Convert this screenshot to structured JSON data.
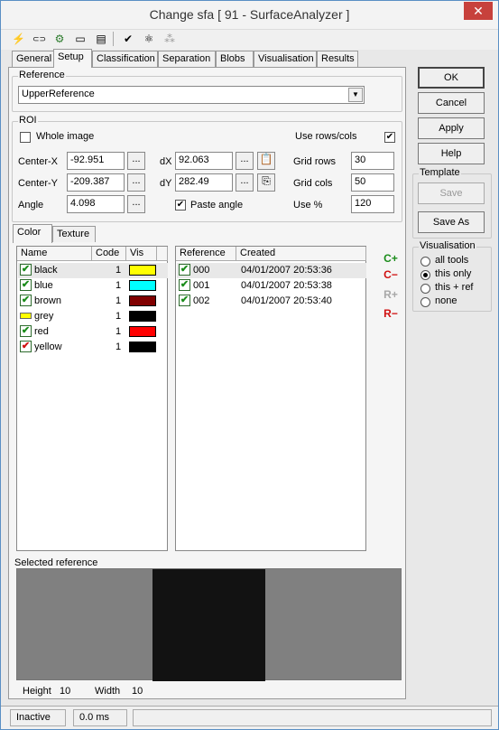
{
  "window": {
    "title": "Change sfa [ 91 - SurfaceAnalyzer ]",
    "close": "✕"
  },
  "toolbar": [
    "⚡",
    "⊂⊃",
    "⚙",
    "▭",
    "▤",
    "✔",
    "⚛",
    "⁂"
  ],
  "tabs": [
    "General",
    "Setup",
    "Classification",
    "Separation",
    "Blobs",
    "Visualisation",
    "Results"
  ],
  "reference": {
    "legend": "Reference",
    "value": "UpperReference",
    "arrow": "▼"
  },
  "roi": {
    "legend": "ROI",
    "whole_image": "Whole image",
    "use_rows_cols": "Use rows/cols",
    "use_rows_cols_checked": "✔",
    "center_x_label": "Center-X",
    "center_x": "-92.951",
    "center_y_label": "Center-Y",
    "center_y": "-209.387",
    "angle_label": "Angle",
    "angle": "4.098",
    "dx_label": "dX",
    "dx": "92.063",
    "dy_label": "dY",
    "dy": "282.49",
    "paste_angle": "Paste angle",
    "paste_angle_checked": "✔",
    "grid_rows_label": "Grid rows",
    "grid_rows": "30",
    "grid_cols_label": "Grid cols",
    "grid_cols": "50",
    "use_pct_label": "Use %",
    "use_pct": "120",
    "ellipsis": "..."
  },
  "subtabs": [
    "Color",
    "Texture"
  ],
  "colors": {
    "headers": [
      "Name",
      "Code",
      "Vis"
    ],
    "rows": [
      {
        "name": "black",
        "code": "1",
        "check": "✔",
        "swatch": "#ffff00"
      },
      {
        "name": "blue",
        "code": "1",
        "check": "✔",
        "swatch": "#00ffff"
      },
      {
        "name": "brown",
        "code": "1",
        "check": "✔",
        "swatch": "#800000"
      },
      {
        "name": "grey",
        "code": "1",
        "check": "",
        "swatch": "#000000"
      },
      {
        "name": "red",
        "code": "1",
        "check": "✔",
        "swatch": "#ff0000"
      },
      {
        "name": "yellow",
        "code": "1",
        "check": "✔",
        "swatch": "#000000"
      }
    ]
  },
  "refs": {
    "headers": [
      "Reference",
      "Created"
    ],
    "rows": [
      {
        "ref": "000",
        "created": "04/01/2007 20:53:36",
        "check": "✔"
      },
      {
        "ref": "001",
        "created": "04/01/2007 20:53:38",
        "check": "✔"
      },
      {
        "ref": "002",
        "created": "04/01/2007 20:53:40",
        "check": "✔"
      }
    ]
  },
  "side_tools": {
    "c_plus": "C+",
    "c_minus": "C−",
    "r_plus": "R+",
    "r_minus": "R−"
  },
  "selected": {
    "label": "Selected reference",
    "height_label": "Height",
    "height": "10",
    "width_label": "Width",
    "width": "10"
  },
  "buttons": {
    "ok": "OK",
    "cancel": "Cancel",
    "apply": "Apply",
    "help": "Help"
  },
  "template": {
    "legend": "Template",
    "save": "Save",
    "save_as": "Save As"
  },
  "visualisation": {
    "legend": "Visualisation",
    "options": [
      "all tools",
      "this only",
      "this + ref",
      "none"
    ],
    "selected": "this only"
  },
  "status": {
    "state": "Inactive",
    "time": "0.0 ms"
  }
}
